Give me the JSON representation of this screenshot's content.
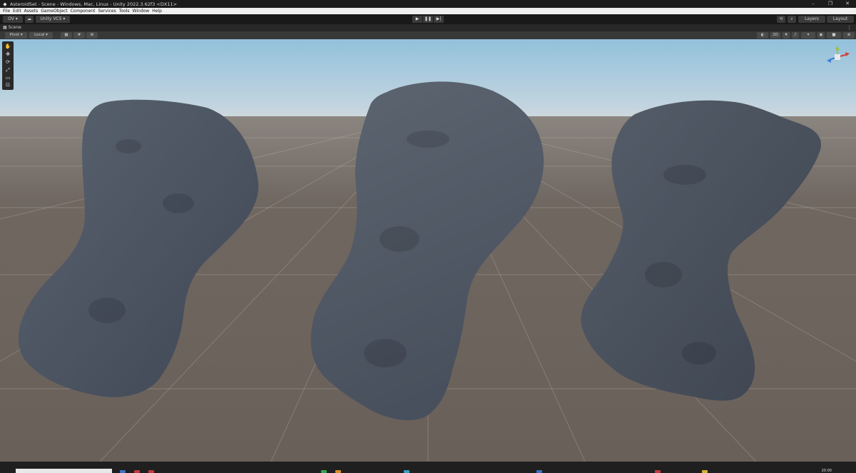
{
  "window": {
    "title": "AsteroidSet - Scene - Windows, Mac, Linux - Unity 2022.3.62f3 <DX11>",
    "controls": [
      "–",
      "❐",
      "✕"
    ]
  },
  "menu": [
    "File",
    "Edit",
    "Assets",
    "GameObject",
    "Component",
    "Services",
    "Tools",
    "Window",
    "Help"
  ],
  "toolbar": {
    "account": "OV ▾",
    "vcs": "Unity VCS ▾",
    "layers": "Layers",
    "layout": "Layout",
    "play_icons": [
      "▶",
      "❚❚",
      "▶|"
    ]
  },
  "scene_tab": {
    "label": "Scene"
  },
  "scene_toolbar": {
    "pivot": "Pivot ▾",
    "local": "Local ▾",
    "mode_2d": "2D"
  },
  "clock": "20:00",
  "colors": {
    "sky_top": "#9cc6df",
    "horizon": "#c6d6e0",
    "ground": "#6b625c",
    "asteroid": "#4c5563"
  }
}
